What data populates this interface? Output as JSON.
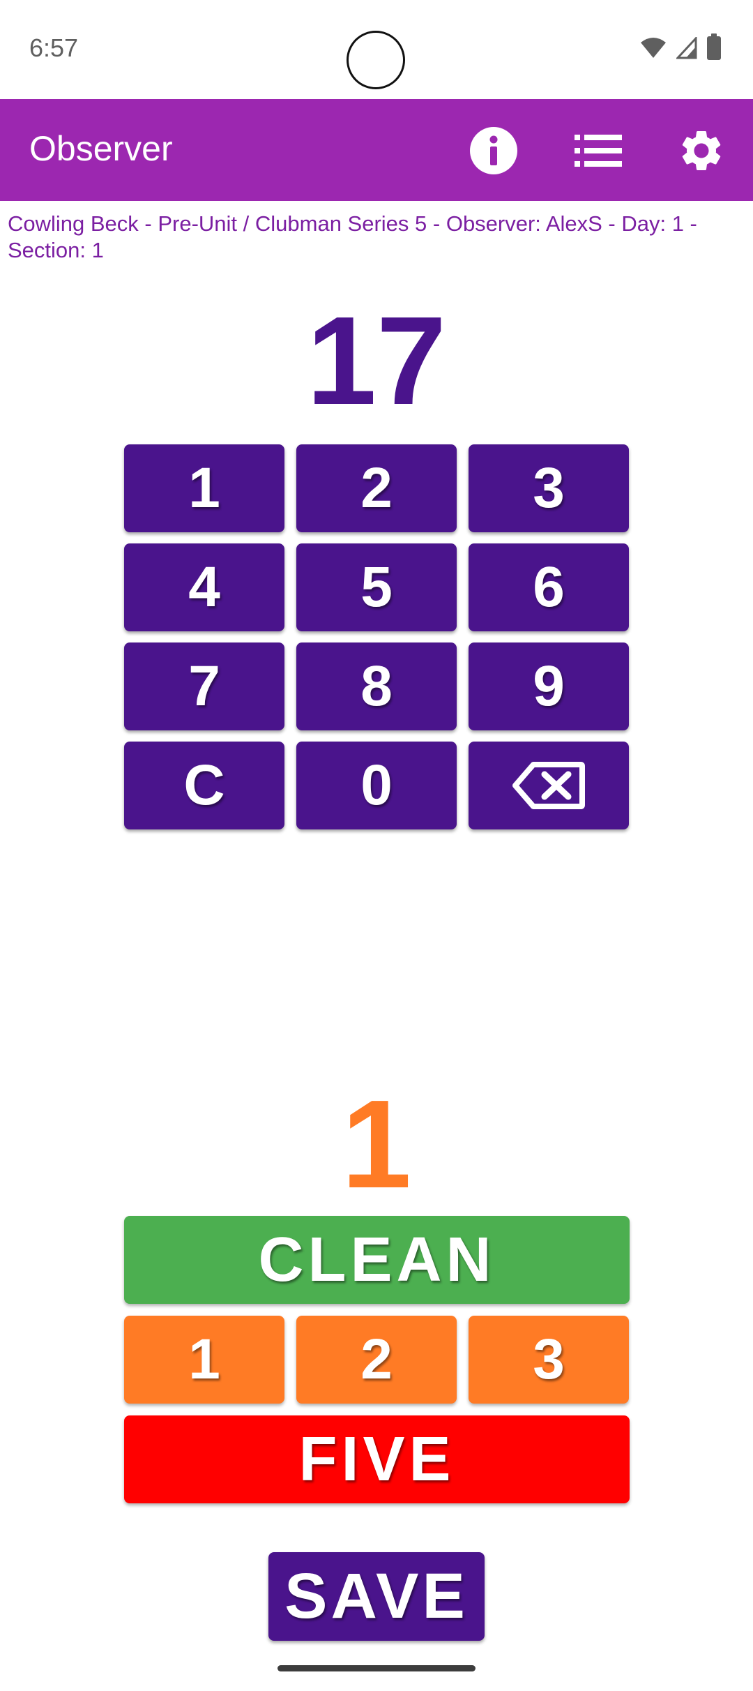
{
  "status_bar": {
    "time": "6:57",
    "icons": [
      "wifi-icon",
      "cell-signal-icon",
      "battery-icon"
    ]
  },
  "app_bar": {
    "title": "Observer",
    "actions": [
      "info-icon",
      "list-icon",
      "settings-gear-icon"
    ],
    "color": "#9c27b0"
  },
  "subtitle": "Cowling Beck - Pre-Unit / Clubman Series 5 - Observer: AlexS - Day: 1 - Section: 1",
  "rider_number": "17",
  "keypad": {
    "keys": [
      "1",
      "2",
      "3",
      "4",
      "5",
      "6",
      "7",
      "8",
      "9",
      "C",
      "0"
    ],
    "backspace_icon": "backspace-icon",
    "color": "#4a148c"
  },
  "penalty_value": "1",
  "scoring": {
    "clean": "CLEAN",
    "dab_1": "1",
    "dab_2": "2",
    "dab_3": "3",
    "five": "FIVE",
    "colors": {
      "clean": "#4caf50",
      "dabs": "#ff7b25",
      "five": "#ff0000"
    }
  },
  "save_label": "SAVE"
}
